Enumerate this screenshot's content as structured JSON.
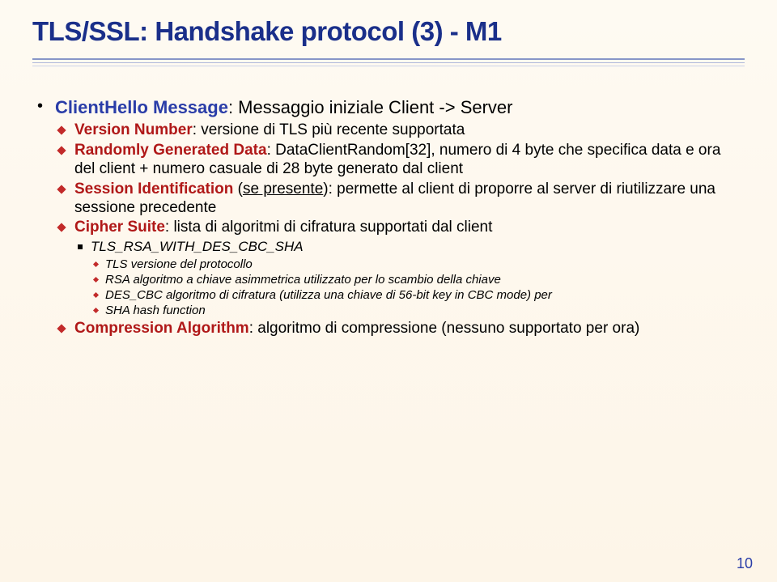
{
  "title": "TLS/SSL: Handshake protocol (3) - M1",
  "page_number": "10",
  "b0_strong": "ClientHello Message",
  "b0_rest": ": Messaggio iniziale Client -> Server",
  "b0_s0_strong": "Version Number",
  "b0_s0_rest": ": versione di TLS più recente supportata",
  "b0_s1_strong": "Randomly Generated Data",
  "b0_s1_rest": ": DataClientRandom[32], numero di 4 byte che specifica data e ora del client + numero casuale di 28 byte generato dal client",
  "b0_s2_strong": "Session Identification",
  "b0_s2_mid": " (",
  "b0_s2_underline": "se presente",
  "b0_s2_rest": "): permette al client di proporre al server di riutilizzare una sessione precedente",
  "b0_s3_strong": "Cipher Suite",
  "b0_s3_rest": ": lista di algoritmi di cifratura supportati dal client",
  "b0_s3_c0": "TLS_RSA_WITH_DES_CBC_SHA",
  "b0_s3_c0_d0": "TLS versione del protocollo",
  "b0_s3_c0_d1": "RSA algoritmo a chiave asimmetrica utilizzato per lo scambio della chiave",
  "b0_s3_c0_d2": "DES_CBC algoritmo di cifratura (utilizza una chiave di 56-bit key in CBC mode) per",
  "b0_s3_c0_d3": "SHA hash function",
  "b0_s4_strong": "Compression Algorithm",
  "b0_s4_rest": ": algoritmo di compressione (nessuno supportato per ora)"
}
